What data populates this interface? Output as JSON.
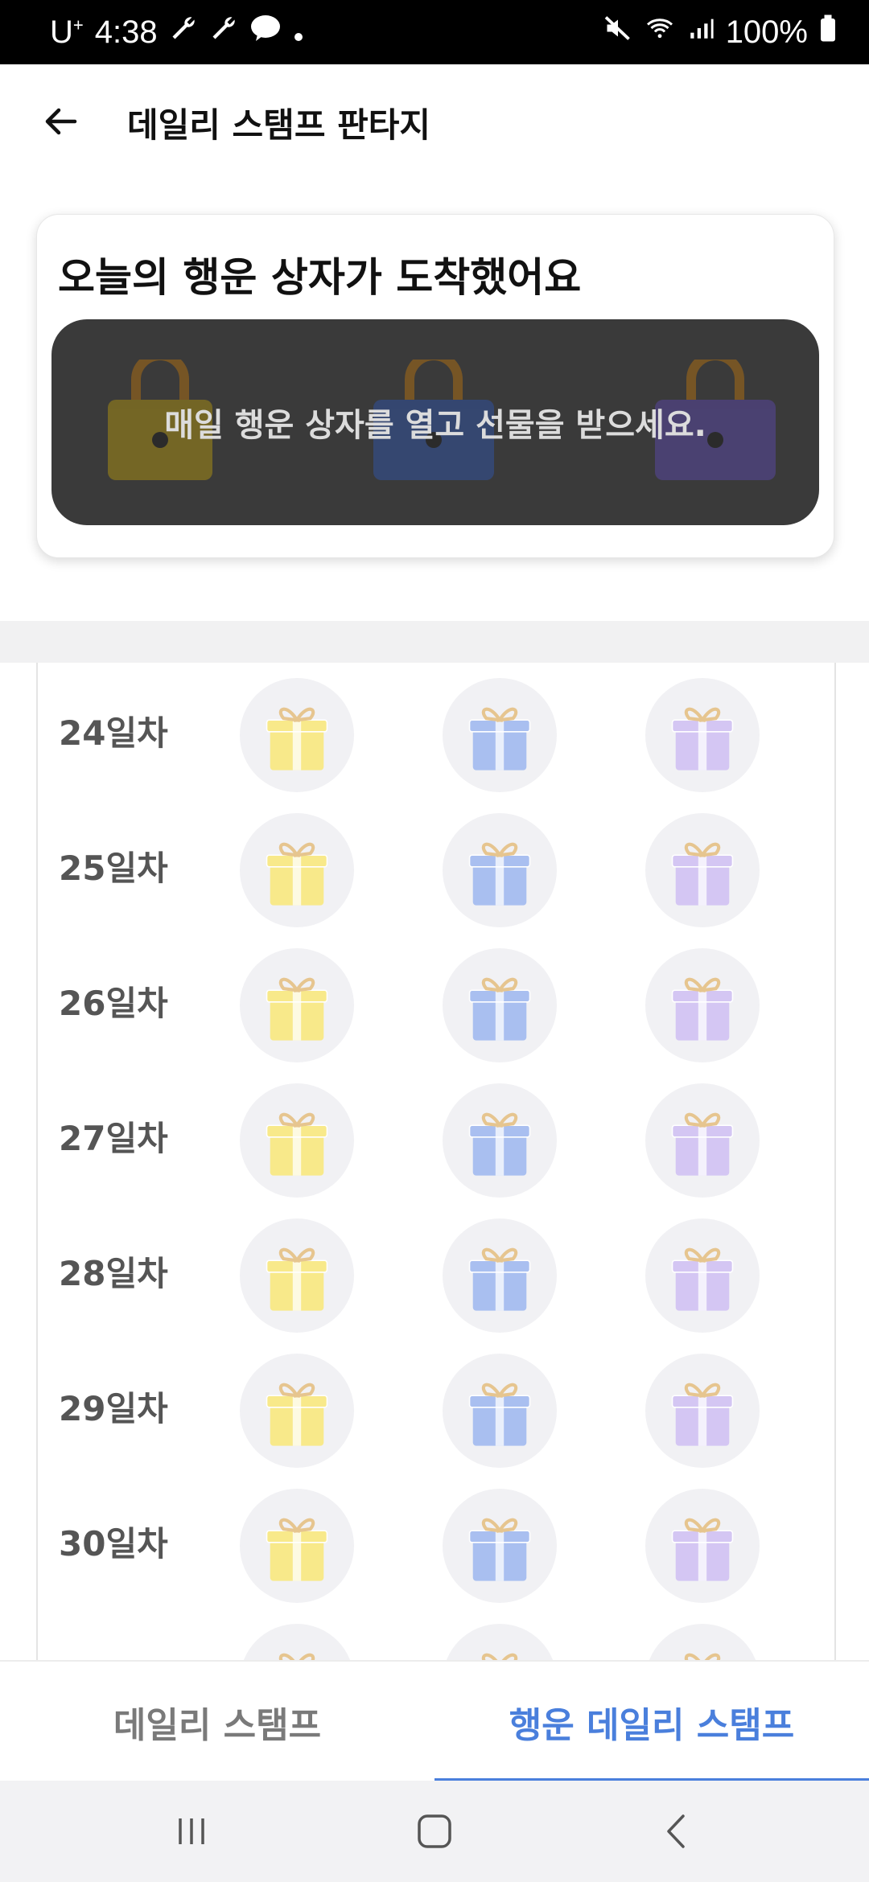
{
  "status_bar": {
    "carrier": "U",
    "carrier_sup": "+",
    "time": "4:38",
    "battery": "100%"
  },
  "header": {
    "title": "데일리 스탬프 판타지"
  },
  "lucky_box": {
    "title": "오늘의 행운 상자가 도착했어요",
    "message": "매일 행운 상자를 열고 선물을 받으세요."
  },
  "calendar": {
    "days": [
      {
        "label": "24일차"
      },
      {
        "label": "25일차"
      },
      {
        "label": "26일차"
      },
      {
        "label": "27일차"
      },
      {
        "label": "28일차"
      },
      {
        "label": "29일차"
      },
      {
        "label": "30일차"
      }
    ],
    "gift_colors": [
      "#f8e98a",
      "#a9bff0",
      "#d4c6f3"
    ]
  },
  "tabs": [
    {
      "label": "데일리 스탬프",
      "active": false
    },
    {
      "label": "행운 데일리 스탬프",
      "active": true
    }
  ],
  "accent_color": "#4a7fdc"
}
